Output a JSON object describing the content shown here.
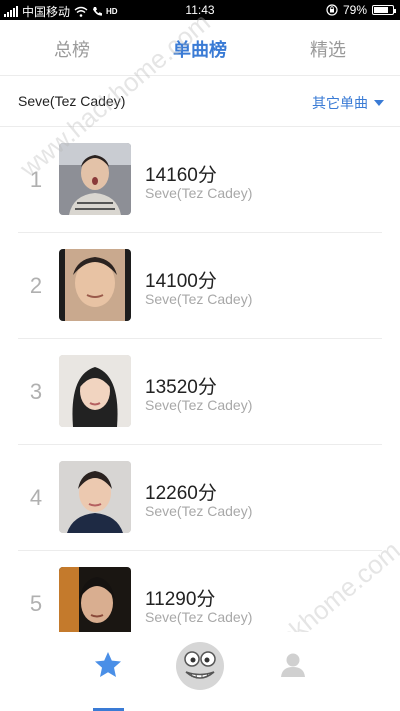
{
  "status_bar": {
    "carrier": "中国移动",
    "network_badge": "HD",
    "time": "11:43",
    "battery": "79%",
    "battery_level": 0.79
  },
  "tabs": [
    {
      "label": "总榜",
      "active": false
    },
    {
      "label": "单曲榜",
      "active": true
    },
    {
      "label": "精选",
      "active": false
    }
  ],
  "song": {
    "title": "Seve(Tez Cadey)",
    "other_label": "其它单曲"
  },
  "ranking": [
    {
      "rank": "1",
      "score": "14160分",
      "artist": "Seve(Tez Cadey)"
    },
    {
      "rank": "2",
      "score": "14100分",
      "artist": "Seve(Tez Cadey)"
    },
    {
      "rank": "3",
      "score": "13520分",
      "artist": "Seve(Tez Cadey)"
    },
    {
      "rank": "4",
      "score": "12260分",
      "artist": "Seve(Tez Cadey)"
    },
    {
      "rank": "5",
      "score": "11290分",
      "artist": "Seve(Tez Cadey)"
    }
  ],
  "watermark": "www.hackhome.com",
  "colors": {
    "accent": "#3a7bd5",
    "muted": "#a8a8a8"
  }
}
